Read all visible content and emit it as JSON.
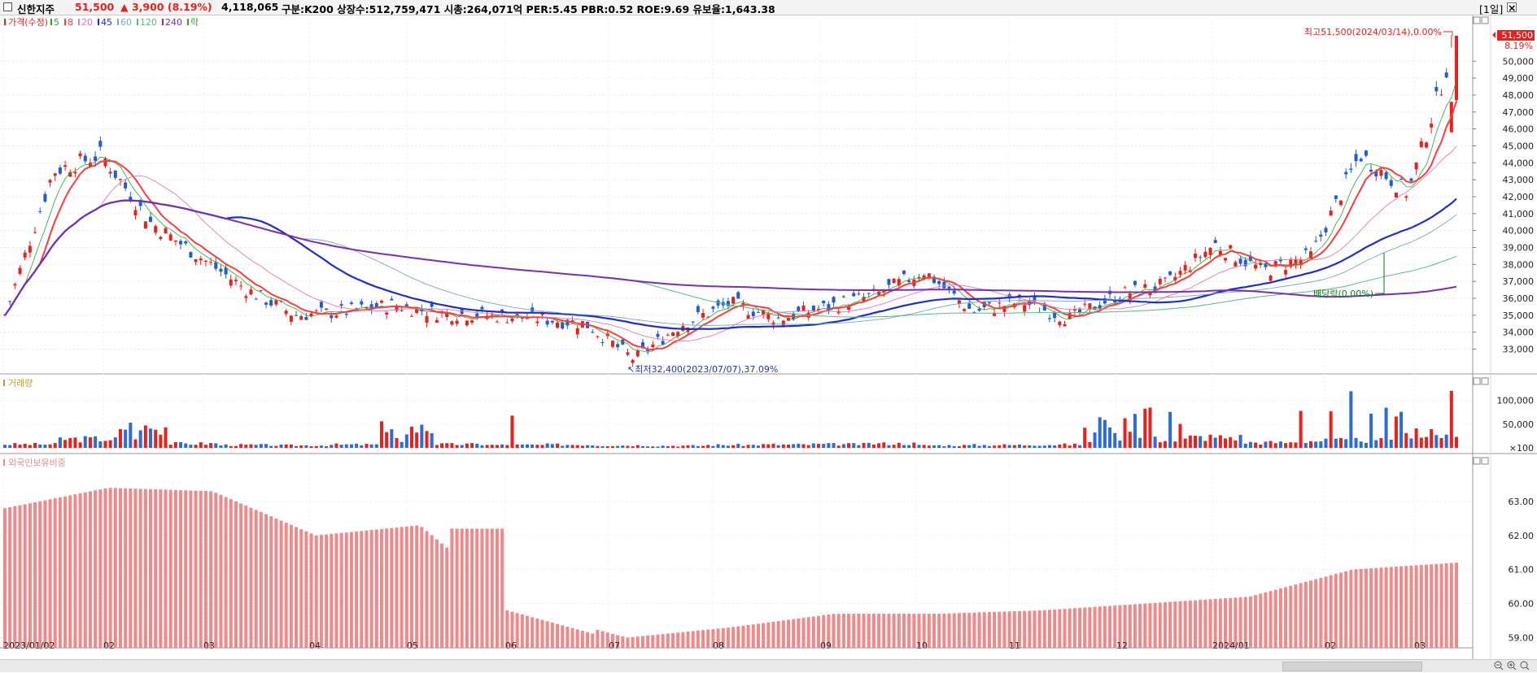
{
  "header": {
    "name": "신한지주",
    "price": "51,500",
    "change": "▲ 3,900 (8.19%)",
    "volume": "4,118,065",
    "stats": "구분:K200  상장수:512,759,471  시총:264,071억  PER:5.45  PBR:0.52  ROE:9.69  유보율:1,643.38",
    "period_button": "[1일]"
  },
  "legend": {
    "price_label": "가격(수정)",
    "ma": [
      {
        "label": "5",
        "color": "#2aa52a"
      },
      {
        "label": "8",
        "color": "#ff3c3c"
      },
      {
        "label": "20",
        "color": "#e07ab8"
      },
      {
        "label": "45",
        "color": "#1e2fd0"
      },
      {
        "label": "60",
        "color": "#7aa6c2"
      },
      {
        "label": "120",
        "color": "#56b98a"
      },
      {
        "label": "240",
        "color": "#7b2fb0"
      }
    ],
    "ex_label": "락"
  },
  "annotations": {
    "high": "최고51,500(2024/03/14),0.00%",
    "low": "최저32,400(2023/07/07),37.09%",
    "dividend": "배당락(0.00%)",
    "last_price": "51,500",
    "last_pct": "8.19%"
  },
  "colors": {
    "up": "#e8211d",
    "down": "#1e5fd0",
    "volume_up": "#e8211d",
    "volume_down": "#2d6bd6",
    "foreign": "#f08a8a"
  },
  "panels": {
    "volume_title": "거래량",
    "foreign_title": "외국인보유비중"
  },
  "chart_data": [
    {
      "type": "candlestick",
      "title": "가격(수정)",
      "x": [
        "2023/01/02",
        "2023/01/15",
        "2023/02/01",
        "2023/02/15",
        "2023/03/01",
        "2023/03/15",
        "2023/04/01",
        "2023/04/15",
        "2023/05/01",
        "2023/05/15",
        "2023/06/01",
        "2023/06/15",
        "2023/07/01",
        "2023/07/07",
        "2023/07/15",
        "2023/08/01",
        "2023/08/15",
        "2023/09/01",
        "2023/09/15",
        "2023/10/01",
        "2023/10/15",
        "2023/11/01",
        "2023/11/15",
        "2023/12/01",
        "2023/12/15",
        "2024/01/01",
        "2024/01/15",
        "2024/02/01",
        "2024/02/15",
        "2024/03/01",
        "2024/03/14"
      ],
      "close": [
        35000,
        43500,
        44500,
        40500,
        38500,
        36500,
        35000,
        35200,
        35600,
        35100,
        35000,
        34800,
        34500,
        32400,
        34500,
        35700,
        34800,
        35500,
        36200,
        37600,
        35200,
        35800,
        34800,
        36200,
        36800,
        39200,
        37600,
        38500,
        44500,
        42200,
        51500
      ],
      "ylim": [
        32400,
        51500
      ],
      "yticks": [
        33000,
        34000,
        35000,
        36000,
        37000,
        38000,
        39000,
        40000,
        41000,
        42000,
        43000,
        44000,
        45000,
        46000,
        47000,
        48000,
        49000,
        50000
      ],
      "xticks": [
        "2023/01/02",
        "02",
        "03",
        "04",
        "05",
        "06",
        "07",
        "08",
        "09",
        "10",
        "11",
        "12",
        "2024/01",
        "02",
        "03"
      ],
      "high": {
        "value": 51500,
        "date": "2024/03/14"
      },
      "low": {
        "value": 32400,
        "date": "2023/07/07"
      }
    },
    {
      "type": "bar",
      "title": "거래량",
      "yticks": [
        100,
        50000,
        100000
      ],
      "ytick_labels": [
        "×100",
        "50,000",
        "100,000"
      ],
      "values_approx_x100": [
        10000,
        25000,
        60000,
        12000,
        8000,
        7000,
        9000,
        55000,
        10000,
        8000,
        9000,
        7000,
        6000,
        8000,
        9000,
        10000,
        12000,
        7000,
        8000,
        9000,
        65000,
        100000,
        30000,
        15000,
        20000,
        120000,
        40000
      ]
    },
    {
      "type": "bar",
      "title": "외국인보유비중",
      "ylim": [
        58.7,
        64.0
      ],
      "yticks": [
        59.0,
        60.0,
        61.0,
        62.0,
        63.0
      ],
      "ytick_labels": [
        "59.00",
        "60.00",
        "61.00",
        "62.00",
        "63.00"
      ],
      "x": [
        "2023/01",
        "2023/02",
        "2023/03",
        "2023/04",
        "2023/05",
        "2023/06",
        "2023/07",
        "2023/08",
        "2023/09",
        "2023/10",
        "2023/11",
        "2023/12",
        "2024/01",
        "2024/02",
        "2024/03"
      ],
      "values": [
        62.8,
        63.4,
        63.3,
        62.0,
        62.3,
        59.8,
        59.0,
        59.3,
        59.7,
        59.7,
        59.8,
        60.0,
        60.2,
        61.0,
        61.2
      ]
    }
  ]
}
